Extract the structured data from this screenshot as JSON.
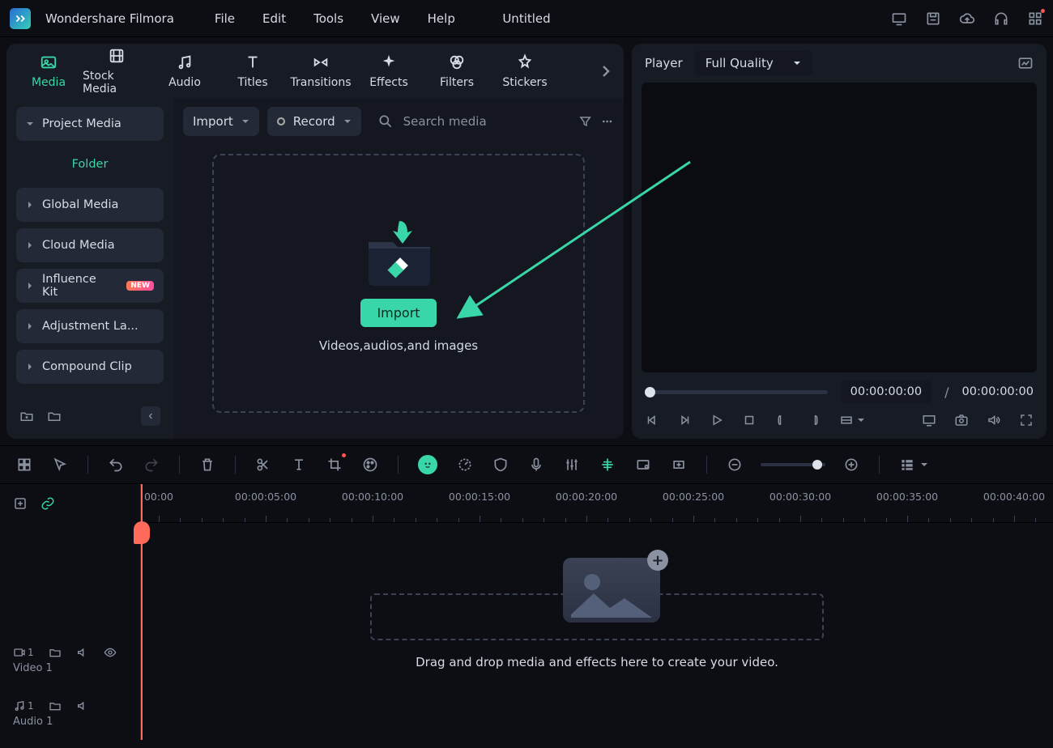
{
  "app_name": "Wondershare Filmora",
  "menus": [
    "File",
    "Edit",
    "Tools",
    "View",
    "Help"
  ],
  "document_title": "Untitled",
  "tabs": [
    {
      "label": "Media",
      "icon": "image",
      "active": true
    },
    {
      "label": "Stock Media",
      "icon": "film"
    },
    {
      "label": "Audio",
      "icon": "music"
    },
    {
      "label": "Titles",
      "icon": "type"
    },
    {
      "label": "Transitions",
      "icon": "shuffle"
    },
    {
      "label": "Effects",
      "icon": "sparkle"
    },
    {
      "label": "Filters",
      "icon": "drops"
    },
    {
      "label": "Stickers",
      "icon": "star"
    }
  ],
  "sidebar": {
    "items": [
      {
        "label": "Project Media",
        "expanded": true
      },
      {
        "label": "Folder",
        "child": true,
        "accent": true
      },
      {
        "label": "Global Media"
      },
      {
        "label": "Cloud Media"
      },
      {
        "label": "Influence Kit",
        "badge": "NEW"
      },
      {
        "label": "Adjustment La..."
      },
      {
        "label": "Compound Clip"
      }
    ]
  },
  "media_bar": {
    "import": "Import",
    "record": "Record",
    "search_placeholder": "Search media"
  },
  "drop": {
    "button": "Import",
    "hint": "Videos,audios,and images"
  },
  "player": {
    "label": "Player",
    "quality": "Full Quality",
    "current": "00:00:00:00",
    "separator": "/",
    "total": "00:00:00:00"
  },
  "ruler": [
    "00:00",
    "00:00:05:00",
    "00:00:10:00",
    "00:00:15:00",
    "00:00:20:00",
    "00:00:25:00",
    "00:00:30:00",
    "00:00:35:00",
    "00:00:40:00"
  ],
  "tracks": {
    "video": {
      "index": "1",
      "name": "Video 1"
    },
    "audio": {
      "index": "1",
      "name": "Audio 1"
    }
  },
  "timeline_hint": "Drag and drop media and effects here to create your video."
}
